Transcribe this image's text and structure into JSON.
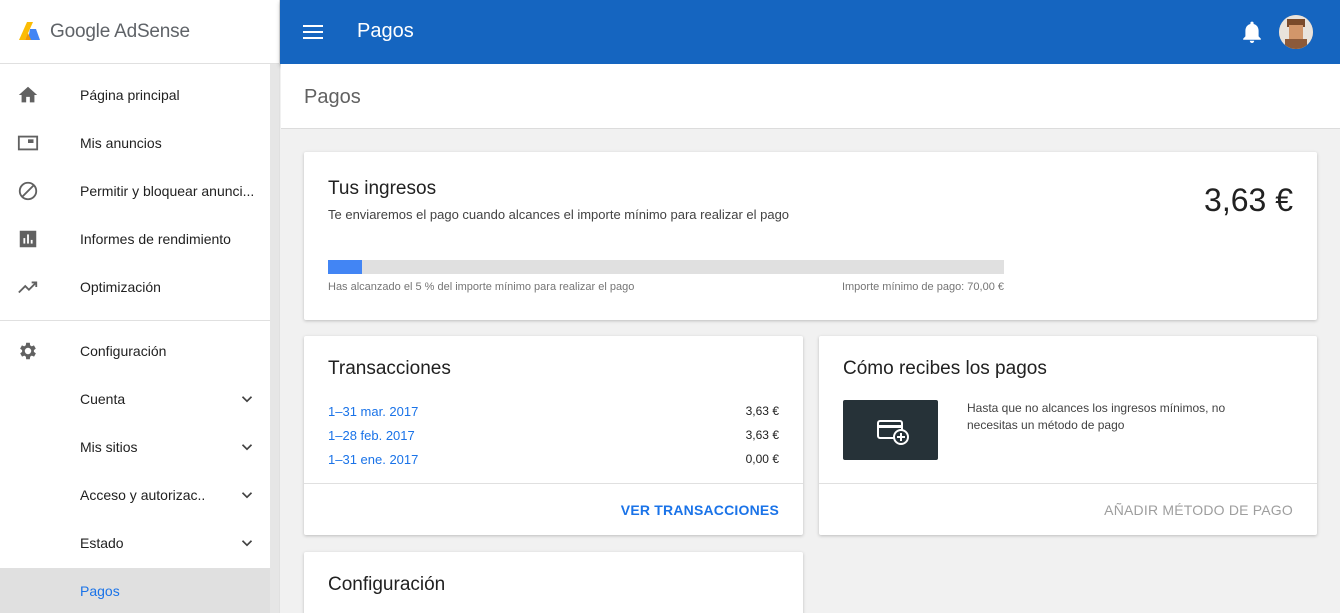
{
  "app": {
    "logo_text": "Google AdSense"
  },
  "topbar": {
    "title": "Pagos",
    "menu_icon": "menu-icon",
    "notification_icon": "bell-icon"
  },
  "sidebar": {
    "group1": [
      {
        "label": "Página principal",
        "icon": "home-icon"
      },
      {
        "label": "Mis anuncios",
        "icon": "ad-unit-icon"
      },
      {
        "label": "Permitir y bloquear anunci...",
        "icon": "block-icon"
      },
      {
        "label": "Informes de rendimiento",
        "icon": "bar-chart-icon"
      },
      {
        "label": "Optimización",
        "icon": "trending-up-icon"
      }
    ],
    "group2": [
      {
        "label": "Configuración",
        "icon": "gear-icon"
      },
      {
        "label": "Cuenta",
        "expandable": true
      },
      {
        "label": "Mis sitios",
        "expandable": true
      },
      {
        "label": "Acceso y autorizac..",
        "expandable": true
      },
      {
        "label": "Estado",
        "expandable": true
      },
      {
        "label": "Pagos",
        "active": true
      }
    ]
  },
  "page_header": {
    "title": "Pagos"
  },
  "earnings": {
    "title": "Tus ingresos",
    "subtitle": "Te enviaremos el pago cuando alcances el importe mínimo para realizar el pago",
    "amount": "3,63 €",
    "progress_fraction": 0.05,
    "progress_text": "Has alcanzado el 5 % del importe mínimo para realizar el pago",
    "threshold_text": "Importe mínimo de pago: 70,00 €",
    "accent_color": "#4285f4"
  },
  "transactions": {
    "title": "Transacciones",
    "rows": [
      {
        "period": "1–31 mar. 2017",
        "amount": "3,63 €"
      },
      {
        "period": "1–28 feb. 2017",
        "amount": "3,63 €"
      },
      {
        "period": "1–31 ene. 2017",
        "amount": "0,00 €"
      }
    ],
    "action": "VER TRANSACCIONES"
  },
  "payment_method": {
    "title": "Cómo recibes los pagos",
    "icon": "add-payment-card-icon",
    "text": "Hasta que no alcances los ingresos mínimos, no necesitas un método de pago",
    "action": "AÑADIR MÉTODO DE PAGO"
  },
  "settings_card": {
    "title": "Configuración"
  },
  "colors": {
    "topbar": "#1565c0",
    "link": "#1a73e8",
    "payment_box": "#263238"
  }
}
